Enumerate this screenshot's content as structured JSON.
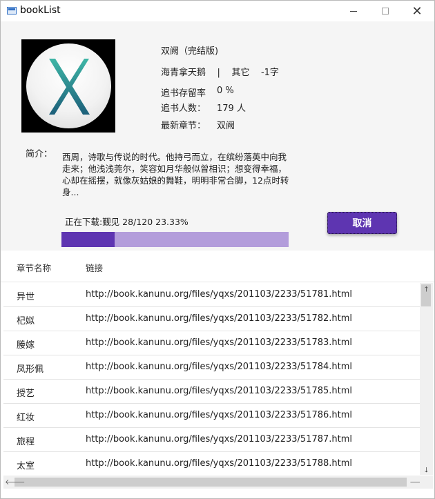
{
  "window": {
    "title": "bookList",
    "close_glyph": "✕"
  },
  "book": {
    "title": "双阙（完结版)",
    "author_line": "海青拿天鹅    |    其它    -1字",
    "retention_label": "追书存留率",
    "retention_value": "0 %",
    "readers_label": "追书人数：",
    "readers_value": "179 人",
    "latest_label": "最新章节：",
    "latest_value": "双阙",
    "intro_label": "简介：",
    "intro_text": "西周，诗歌与传说的时代。他持弓而立，在缤纷落英中向我走来；他浅浅莞尔，笑容如月华般似曾相识；想变得幸福，心却在摇摆，就像灰姑娘的舞鞋，明明非常合脚，12点时转身..."
  },
  "download": {
    "status_text": "正在下载:觐见 28/120 23.33%",
    "progress_fraction": 0.2333,
    "cancel_label": "取消",
    "accent_color": "#5e35b1",
    "track_color": "#b39ddb"
  },
  "table": {
    "columns": [
      "章节名称",
      "链接"
    ],
    "rows": [
      {
        "name": "异世",
        "link": "http://book.kanunu.org/files/yqxs/201103/2233/51781.html"
      },
      {
        "name": "杞姒",
        "link": "http://book.kanunu.org/files/yqxs/201103/2233/51782.html"
      },
      {
        "name": "媵嫁",
        "link": "http://book.kanunu.org/files/yqxs/201103/2233/51783.html"
      },
      {
        "name": "凤形佩",
        "link": "http://book.kanunu.org/files/yqxs/201103/2233/51784.html"
      },
      {
        "name": "授艺",
        "link": "http://book.kanunu.org/files/yqxs/201103/2233/51785.html"
      },
      {
        "name": "红妆",
        "link": "http://book.kanunu.org/files/yqxs/201103/2233/51786.html"
      },
      {
        "name": "旅程",
        "link": "http://book.kanunu.org/files/yqxs/201103/2233/51787.html"
      },
      {
        "name": "太室",
        "link": "http://book.kanunu.org/files/yqxs/201103/2233/51788.html"
      }
    ]
  },
  "scroll": {
    "up_glyph": "🡑",
    "down_glyph": "🡓",
    "left_glyph": "🡐",
    "right_glyph": "🡒"
  }
}
